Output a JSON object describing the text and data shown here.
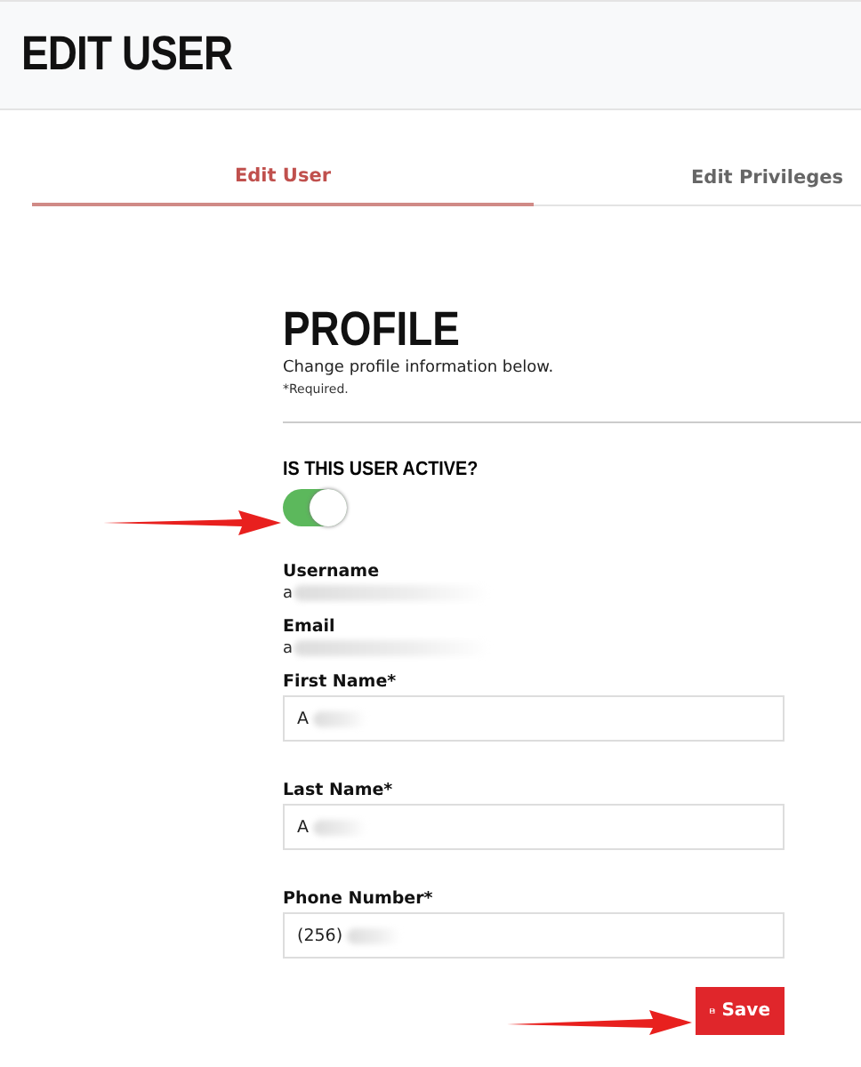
{
  "header": {
    "title": "EDIT USER"
  },
  "tabs": [
    {
      "label": "Edit User",
      "selected": true
    },
    {
      "label": "Edit Privileges",
      "selected": false
    }
  ],
  "profile": {
    "title": "PROFILE",
    "subtitle": "Change profile information below.",
    "note": "*Required."
  },
  "active": {
    "label": "IS THIS USER ACTIVE?",
    "on": true
  },
  "fields": [
    {
      "kind": "text",
      "label": "Username",
      "value": "a"
    },
    {
      "kind": "text",
      "label": "Email",
      "value": "a"
    },
    {
      "kind": "input",
      "label": "First Name*",
      "value": "A"
    },
    {
      "kind": "input",
      "label": "Last Name*",
      "value": "A"
    },
    {
      "kind": "input",
      "label": "Phone Number*",
      "value": "(256)"
    }
  ],
  "save_button": {
    "label": "Save"
  }
}
